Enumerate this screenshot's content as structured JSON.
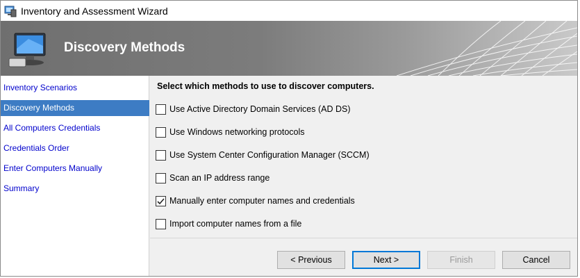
{
  "window": {
    "title": "Inventory and Assessment Wizard"
  },
  "banner": {
    "heading": "Discovery Methods"
  },
  "sidebar": {
    "items": [
      {
        "label": "Inventory Scenarios",
        "active": false
      },
      {
        "label": "Discovery Methods",
        "active": true
      },
      {
        "label": "All Computers Credentials",
        "active": false
      },
      {
        "label": "Credentials Order",
        "active": false
      },
      {
        "label": "Enter Computers Manually",
        "active": false
      },
      {
        "label": "Summary",
        "active": false
      }
    ]
  },
  "main": {
    "instruction": "Select which methods to use to discover computers.",
    "options": [
      {
        "label": "Use Active Directory Domain Services (AD DS)",
        "checked": false
      },
      {
        "label": "Use Windows networking protocols",
        "checked": false
      },
      {
        "label": "Use System Center Configuration Manager (SCCM)",
        "checked": false
      },
      {
        "label": "Scan an IP address range",
        "checked": false
      },
      {
        "label": "Manually enter computer names and credentials",
        "checked": true
      },
      {
        "label": "Import computer names from a file",
        "checked": false
      }
    ]
  },
  "buttons": {
    "previous": "< Previous",
    "next": "Next >",
    "finish": "Finish",
    "cancel": "Cancel"
  },
  "colors": {
    "accent": "#3d7cc4",
    "link": "#0000cc",
    "default_border": "#0078d7"
  },
  "icons": {
    "app": "computer-app-icon",
    "banner": "monitor-icon",
    "check": "checkmark-icon"
  }
}
